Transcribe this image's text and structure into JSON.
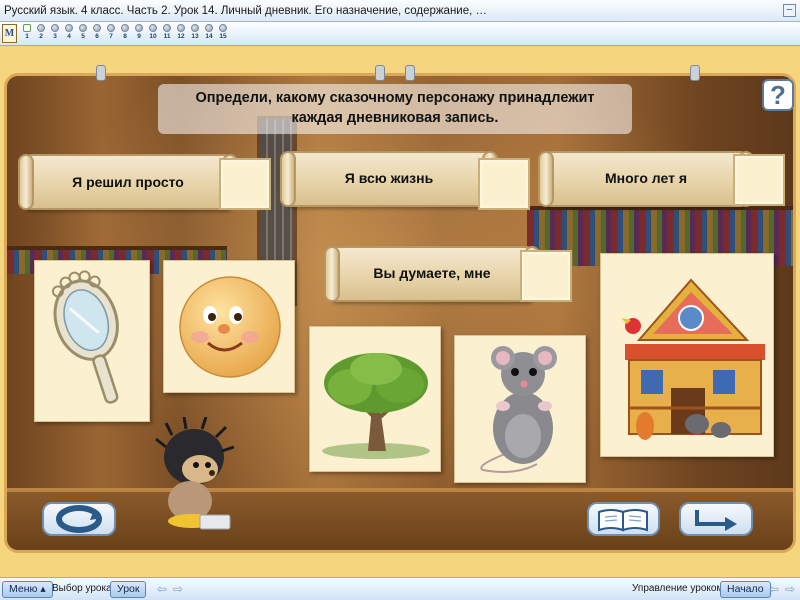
{
  "window": {
    "title": "Русский язык. 4 класс. Часть 2. Урок 14. Личный дневник. Его назначение, содержание, …",
    "minimize_glyph": "–"
  },
  "stepbar": {
    "logo_text": "M",
    "steps": [
      "1",
      "2",
      "3",
      "4",
      "5",
      "6",
      "7",
      "8",
      "9",
      "10",
      "11",
      "12",
      "13",
      "14",
      "15"
    ],
    "active_step": "1"
  },
  "task": {
    "instruction_line1": "Определи, какому сказочному персонажу принадлежит",
    "instruction_line2": "каждая дневниковая запись.",
    "help_label": "?"
  },
  "scrolls": [
    {
      "text": "Я решил просто"
    },
    {
      "text": "Я всю жизнь"
    },
    {
      "text": "Много лет я"
    },
    {
      "text": "Вы думаете, мне"
    }
  ],
  "cards": [
    {
      "character": "mirror"
    },
    {
      "character": "kolobok"
    },
    {
      "character": "tree"
    },
    {
      "character": "mouse"
    },
    {
      "character": "teremok"
    }
  ],
  "stage_buttons": {
    "reset_icon": "refresh-icon",
    "book_icon": "open-book-icon",
    "next_icon": "arrow-right-icon"
  },
  "bottombar": {
    "menu_label": "Меню",
    "lesson_select_label": "Выбор урока:",
    "lesson_button": "Урок",
    "lesson_control_label": "Управление уроком:",
    "start_button": "Начало"
  },
  "colors": {
    "accent": "#5a84b5",
    "scroll": "#e6d2a6",
    "card": "#fbf0cf"
  }
}
